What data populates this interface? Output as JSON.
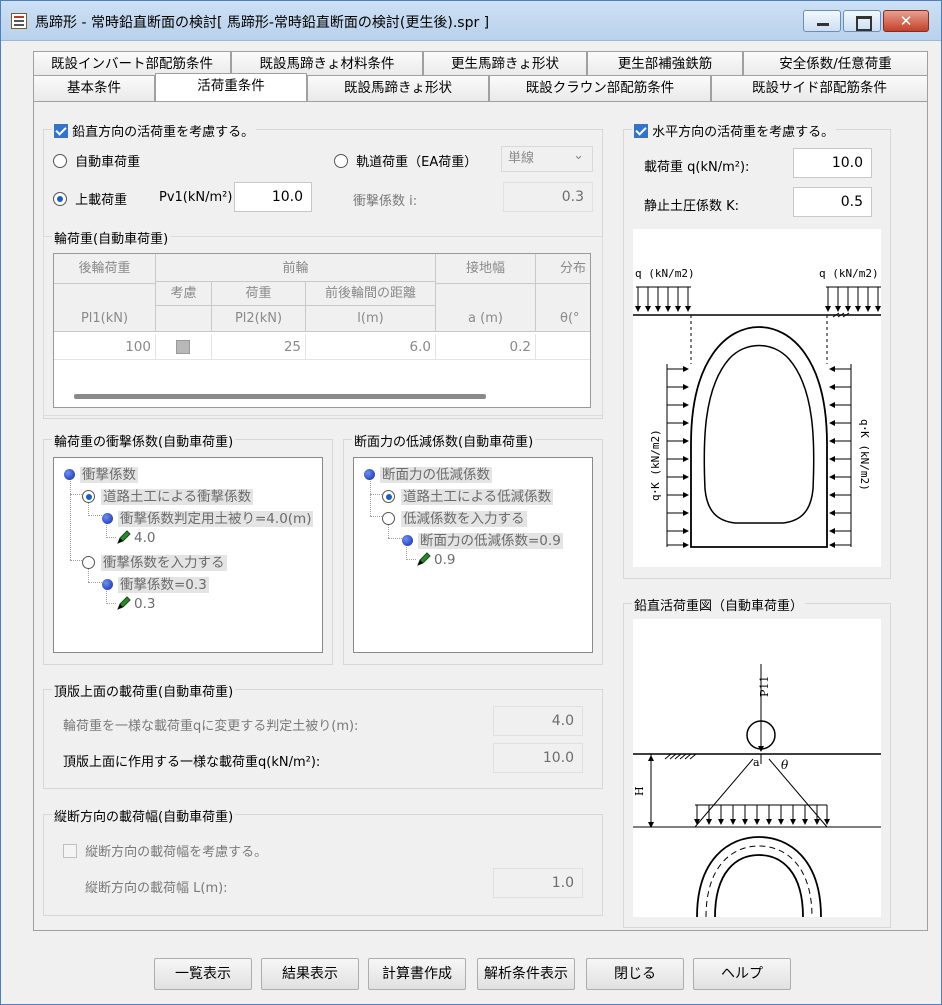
{
  "window": {
    "title": "馬蹄形 - 常時鉛直断面の検討[ 馬蹄形-常時鉛直断面の検討(更生後).spr ]",
    "close_glyph": "✕"
  },
  "tabs_row1": [
    "既設インバート部配筋条件",
    "既設馬蹄きょ材料条件",
    "更生馬蹄きょ形状",
    "更生部補強鉄筋",
    "安全係数/任意荷重"
  ],
  "tabs_row2": [
    "基本条件",
    "活荷重条件",
    "既設馬蹄きょ形状",
    "既設クラウン部配筋条件",
    "既設サイド部配筋条件"
  ],
  "active_tab": "活荷重条件",
  "vertical": {
    "checkbox_label": "鉛直方向の活荷重を考慮する。",
    "radio_auto": "自動車荷重",
    "radio_rail": "軌道荷重（EA荷重）",
    "rail_combo": "単線",
    "radio_surface": "上載荷重",
    "pv1_label": "Pv1(kN/m²):",
    "pv1_value": "10.0",
    "impact_label": "衝撃係数 i:",
    "impact_value": "0.3"
  },
  "wheel": {
    "title": "輪荷重(自動車荷重)",
    "col_rear": "後輪荷重",
    "col_front": "前輪",
    "col_consider": "考慮",
    "col_load": "荷重",
    "col_distance": "前後輪間の距離",
    "col_contact": "接地幅",
    "col_dist": "分布",
    "unit_pl1": "Pl1(kN)",
    "unit_pl2": "Pl2(kN)",
    "unit_l": "l(m)",
    "unit_a": "a (m)",
    "unit_theta": "θ(°",
    "row": {
      "pl1": "100",
      "pl2": "25",
      "l": "6.0",
      "a": "0.2"
    }
  },
  "impact_tree": {
    "title": "輪荷重の衝撃係数(自動車荷重)",
    "root": "衝撃係数",
    "opt1": "道路土工による衝撃係数",
    "opt1_child": "衝撃係数判定用土被り=4.0(m)",
    "opt1_value": "4.0",
    "opt2": "衝撃係数を入力する",
    "opt2_child": "衝撃係数=0.3",
    "opt2_value": "0.3"
  },
  "reduce_tree": {
    "title": "断面力の低減係数(自動車荷重)",
    "root": "断面力の低減係数",
    "opt1": "道路土工による低減係数",
    "opt2": "低減係数を入力する",
    "opt2_child": "断面力の低減係数=0.9",
    "opt2_value": "0.9"
  },
  "top_load": {
    "title": "頂版上面の載荷重(自動車荷重)",
    "label1": "輪荷重を一様な載荷重qに変更する判定土被り(m):",
    "value1": "4.0",
    "label2": "頂版上面に作用する一様な載荷重q(kN/m²):",
    "value2": "10.0"
  },
  "longitudinal": {
    "title": "縦断方向の載荷幅(自動車荷重)",
    "checkbox_label": "縦断方向の載荷幅を考慮する。",
    "width_label": "縦断方向の載荷幅 L(m):",
    "width_value": "1.0"
  },
  "horizontal": {
    "checkbox_label": "水平方向の活荷重を考慮する。",
    "q_label": "載荷重 q(kN/m²):",
    "q_value": "10.0",
    "k_label": "静止土圧係数 K:",
    "k_value": "0.5",
    "diag_q_left": "q (kN/m2)",
    "diag_q_right": "q (kN/m2)",
    "diag_qk_left": "q･K (kN/m2)",
    "diag_qk_right": "q･K (kN/m2)"
  },
  "vertical_diagram": {
    "title": "鉛直活荷重図（自動車荷重）",
    "p_label": "P11",
    "a_label": "a",
    "theta_label": "θ",
    "h_label": "H"
  },
  "buttons": [
    "一覧表示",
    "結果表示",
    "計算書作成",
    "解析条件表示",
    "閉じる",
    "ヘルプ"
  ]
}
